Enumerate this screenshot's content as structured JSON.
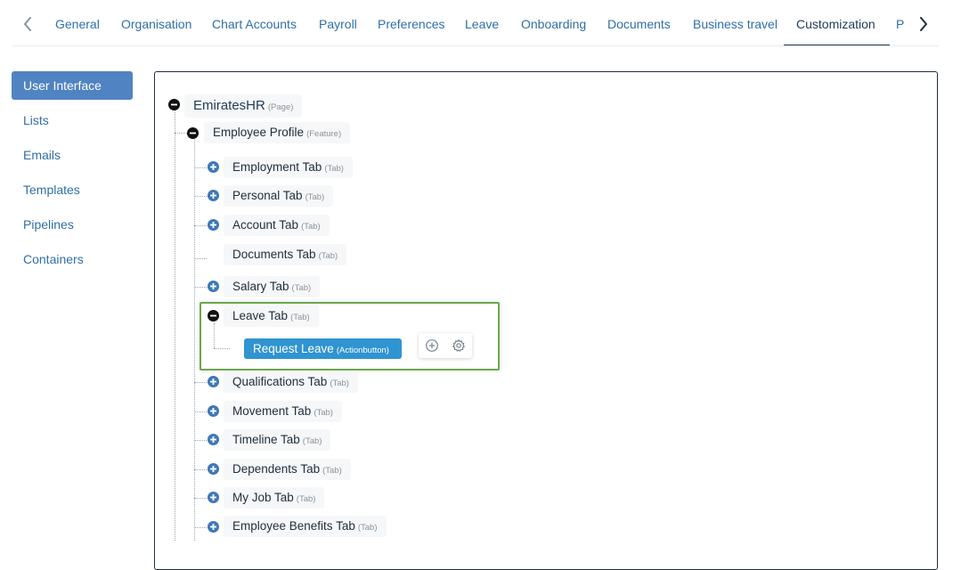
{
  "tabs": [
    {
      "label": "General"
    },
    {
      "label": "Organisation"
    },
    {
      "label": "Chart Accounts"
    },
    {
      "label": "Payroll"
    },
    {
      "label": "Preferences"
    },
    {
      "label": "Leave"
    },
    {
      "label": "Onboarding"
    },
    {
      "label": "Documents"
    },
    {
      "label": "Business travel"
    },
    {
      "label": "Customization"
    },
    {
      "label": "Po"
    }
  ],
  "active_tab": "Customization",
  "sidebar": {
    "items": [
      {
        "label": "User Interface"
      },
      {
        "label": "Lists"
      },
      {
        "label": "Emails"
      },
      {
        "label": "Templates"
      },
      {
        "label": "Pipelines"
      },
      {
        "label": "Containers"
      }
    ],
    "active": "User Interface"
  },
  "tree": {
    "root": {
      "label": "EmiratesHR",
      "type": "(Page)"
    },
    "feature": {
      "label": "Employee Profile",
      "type": "(Feature)"
    },
    "tabs": [
      {
        "label": "Employment Tab",
        "type": "(Tab)"
      },
      {
        "label": "Personal Tab",
        "type": "(Tab)"
      },
      {
        "label": "Account Tab",
        "type": "(Tab)"
      },
      {
        "label": "Documents Tab",
        "type": "(Tab)"
      },
      {
        "label": "Salary Tab",
        "type": "(Tab)"
      },
      {
        "label": "Leave Tab",
        "type": "(Tab)"
      },
      {
        "label": "Qualifications Tab",
        "type": "(Tab)"
      },
      {
        "label": "Movement Tab",
        "type": "(Tab)"
      },
      {
        "label": "Timeline Tab",
        "type": "(Tab)"
      },
      {
        "label": "Dependents Tab",
        "type": "(Tab)"
      },
      {
        "label": "My Job Tab",
        "type": "(Tab)"
      },
      {
        "label": "Employee Benefits Tab",
        "type": "(Tab)"
      }
    ],
    "action": {
      "label": "Request Leave",
      "type": "(Actionbutton)"
    }
  },
  "icons": {
    "prev": "chevron-left-icon",
    "next": "chevron-right-icon",
    "collapse": "minus-circle-icon",
    "expand": "plus-circle-icon",
    "add": "add-circle-icon",
    "settings": "gear-icon"
  },
  "colors": {
    "link": "#2f6fa7",
    "active_side": "#5083c1",
    "action_button": "#2f94d0",
    "highlight_border": "#6aa84f",
    "expand_icon": "#3d78b8"
  }
}
